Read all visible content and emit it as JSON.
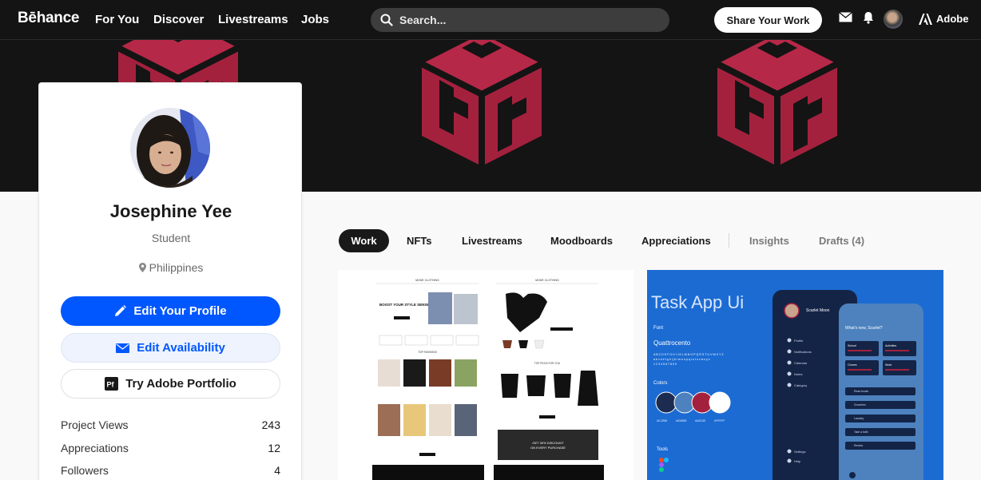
{
  "nav": {
    "logo": "Bēhance",
    "links": [
      "For You",
      "Discover",
      "Livestreams",
      "Jobs"
    ],
    "search_placeholder": "Search...",
    "share_label": "Share Your Work",
    "adobe_label": "Adobe"
  },
  "profile": {
    "name": "Josephine Yee",
    "occupation": "Student",
    "location": "Philippines",
    "edit_profile_label": "Edit Your Profile",
    "edit_availability_label": "Edit Availability",
    "portfolio_label": "Try Adobe Portfolio",
    "stats": [
      {
        "label": "Project Views",
        "value": "243"
      },
      {
        "label": "Appreciations",
        "value": "12"
      },
      {
        "label": "Followers",
        "value": "4"
      }
    ]
  },
  "tabs": [
    "Work",
    "NFTs",
    "Livestreams",
    "Moodboards",
    "Appreciations",
    "Insights",
    "Drafts (4)"
  ],
  "projects": {
    "fashion": {
      "brand": "MODE CLOTHING",
      "hero": "BOOST YOUR STYLE SENSE",
      "section1": "TOP FASHIONS",
      "section2": "TOP PICKS FOR YOU",
      "promo1": "GET 30% DISCOUNT",
      "promo2": "ON EVERY PURCHASE"
    },
    "task_app": {
      "title": "Task App Ui",
      "font_heading": "Font",
      "font_name": "Quattrocento",
      "alphabet1": "A B C D E F G H I J K L M N O P Q R S T U V W X Y Z",
      "alphabet2": "a b c d e f g h i j k l m n o p q r s t u v w x y z",
      "digits": "1 2 3 4 5 6 7 8 9 0",
      "colors_heading": "Colors",
      "color_codes": [
        "#1C2B50",
        "#4D82BE",
        "#A4213E",
        "#FFFFFF"
      ],
      "tools_heading": "Tools",
      "user_name": "Scarlet Moon",
      "menu": [
        "Profile",
        "Notifications",
        "Calendar",
        "Notes",
        "Category"
      ],
      "menu_bottom": [
        "Settings",
        "Help"
      ],
      "greeting": "What's new, Scarlet?",
      "cards": [
        "School",
        "Activities",
        "Chores",
        "Work"
      ],
      "tasks": [
        "Read books",
        "Groceries",
        "Laundry",
        "Take a bath",
        "Review"
      ]
    }
  },
  "colors": {
    "nav_bg": "#141414",
    "accent_blue": "#0057FF",
    "banner_red": "#A4213E"
  }
}
